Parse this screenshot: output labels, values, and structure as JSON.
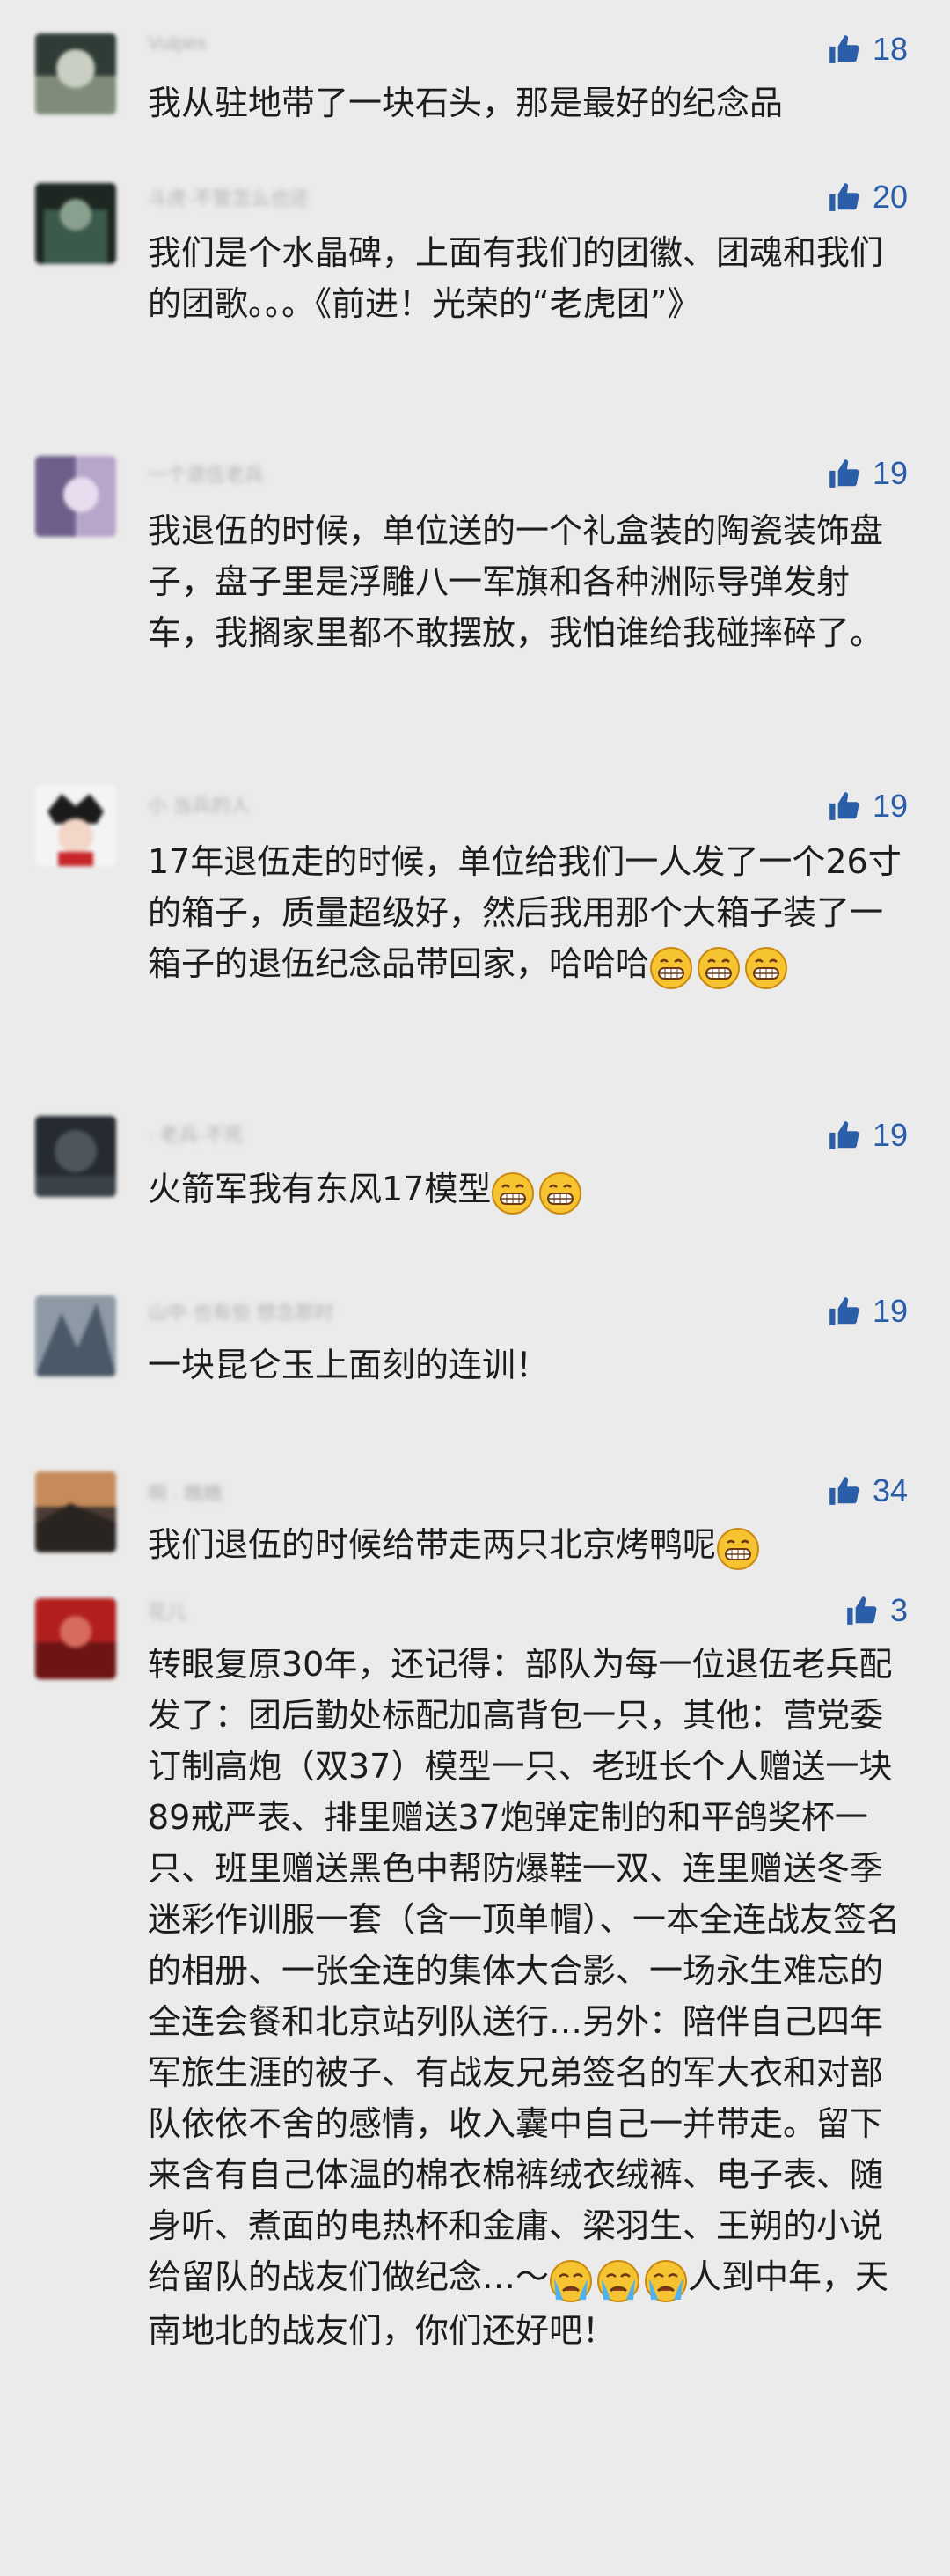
{
  "comments": [
    {
      "author": "Vulpes",
      "likes": "18",
      "text": "我从驻地带了一块石头，那是最好的纪念品",
      "avatar_color": "#2f3b35",
      "emoji": "",
      "emoji_count": 0,
      "tail": ""
    },
    {
      "author": "斗虎·不管怎么也还",
      "likes": "20",
      "text": "我们是个水晶碑，上面有我们的团徽、团魂和我们的团歌。。。《前进！光荣的“老虎团”》",
      "avatar_color": "#1d2621",
      "emoji": "",
      "emoji_count": 0,
      "tail": ""
    },
    {
      "author": "一个退伍老兵",
      "likes": "19",
      "text": "我退伍的时候，单位送的一个礼盒装的陶瓷装饰盘子，盘子里是浮雕八一军旗和各种洲际导弹发射车，我搁家里都不敢摆放，我怕谁给我碰摔碎了。",
      "avatar_color": "#6d5f8a",
      "emoji": "",
      "emoji_count": 0,
      "tail": ""
    },
    {
      "author": "小 当兵的人",
      "likes": "19",
      "text": "17年退伍走的时候，单位给我们一人发了一个26寸的箱子，质量超级好，然后我用那个大箱子装了一箱子的退伍纪念品带回家，哈哈哈",
      "avatar_color": "#c8262a",
      "emoji": "grin",
      "emoji_count": 3,
      "tail": ""
    },
    {
      "author": "· 老兵·不死",
      "likes": "19",
      "text": "火箭军我有东风17模型",
      "avatar_color": "#252b30",
      "emoji": "grin",
      "emoji_count": 2,
      "tail": ""
    },
    {
      "author": "山中·也有些 想念那时",
      "likes": "19",
      "text": "一块昆仑玉上面刻的连训！",
      "avatar_color": "#4a5968",
      "emoji": "",
      "emoji_count": 0,
      "tail": ""
    },
    {
      "author": "啊 · 瞧瞧",
      "likes": "34",
      "text": "我们退伍的时候给带走两只北京烤鸭呢",
      "avatar_color": "#4a3b33",
      "emoji": "grin",
      "emoji_count": 1,
      "tail": ""
    },
    {
      "author": "花儿",
      "likes": "3",
      "text": "转眼复原30年，还记得：部队为每一位退伍老兵配发了：团后勤处标配加高背包一只，其他：营党委订制高炮（双37）模型一只、老班长个人赠送一块89戒严表、排里赠送37炮弹定制的和平鸽奖杯一只、班里赠送黑色中帮防爆鞋一双、连里赠送冬季迷彩作训服一套（含一顶单帽）、一本全连战友签名的相册、一张全连的集体大合影、一场永生难忘的全连会餐和北京站列队送行…另外：陪伴自己四年军旅生涯的被子、有战友兄弟签名的军大衣和对部队依依不舍的感情，收入囊中自己一并带走。留下来含有自己体温的棉衣棉裤绒衣绒裤、电子表、随身听、煮面的电热杯和金庸、梁羽生、王朔的小说给留队的战友们做纪念…～",
      "avatar_color": "#b21e1e",
      "emoji": "cry",
      "emoji_count": 3,
      "tail": "人到中年，天南地北的战友们，你们还好吧！"
    }
  ]
}
